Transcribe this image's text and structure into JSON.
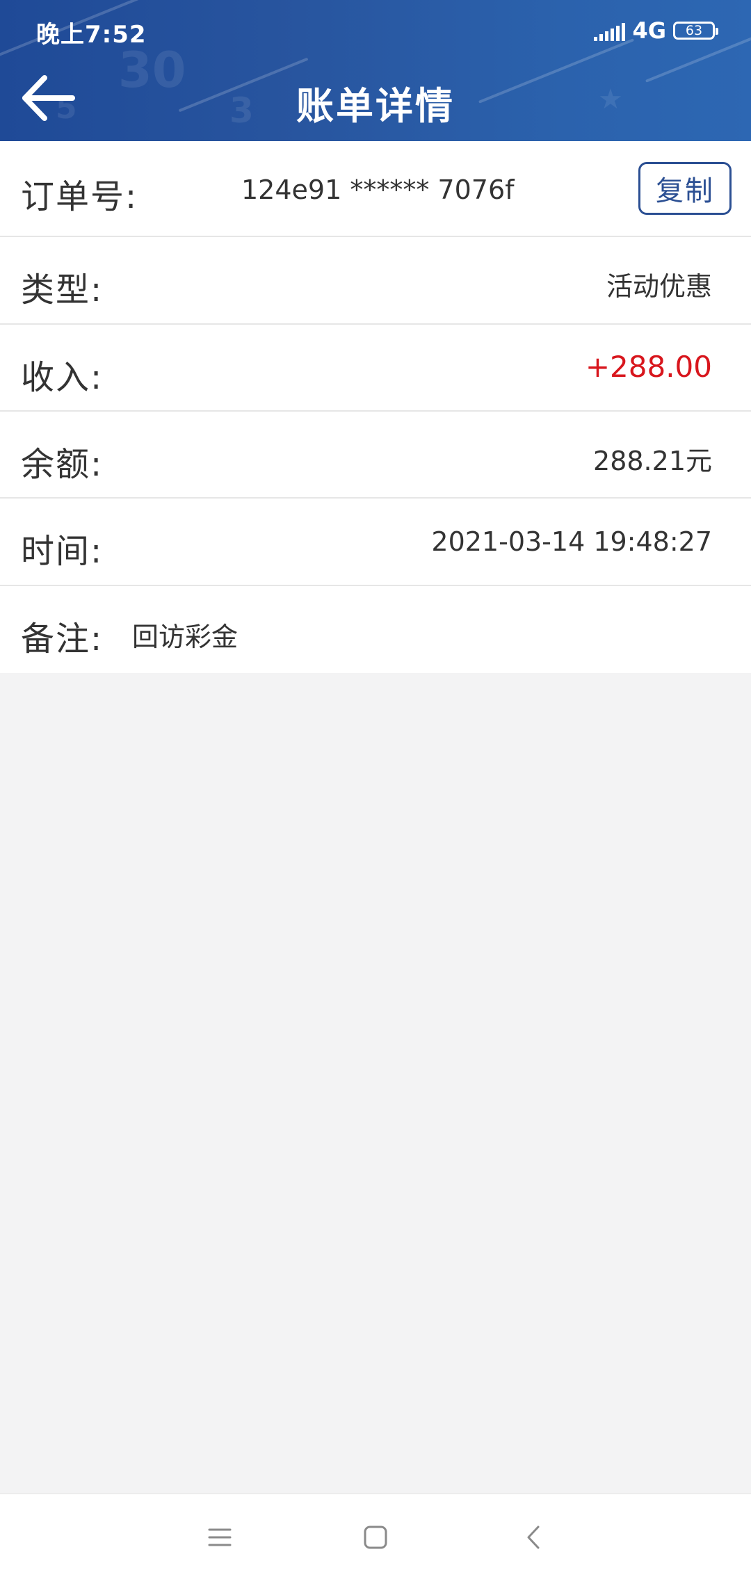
{
  "status_bar": {
    "time": "晚上7:52",
    "network": "4G",
    "battery": "63"
  },
  "header": {
    "title": "账单详情",
    "back_icon": "arrow-left-icon"
  },
  "details": {
    "order_label": "订单号:",
    "order_value": "124e91 ****** 7076f",
    "copy_label": "复制",
    "type_label": "类型:",
    "type_value": "活动优惠",
    "income_label": "收入:",
    "income_value": "+288.00",
    "balance_label": "余额:",
    "balance_value": "288.21元",
    "time_label": "时间:",
    "time_value": "2021-03-14 19:48:27",
    "note_label": "备注:",
    "note_value": "回访彩金"
  },
  "colors": {
    "header_bg": "#28559f",
    "income": "#d8161d",
    "copy_border": "#2b4f93",
    "page_bg": "#f3f3f4"
  },
  "navbar": {
    "menu_icon": "menu-icon",
    "home_icon": "home-square-icon",
    "back_icon": "chevron-left-icon"
  }
}
